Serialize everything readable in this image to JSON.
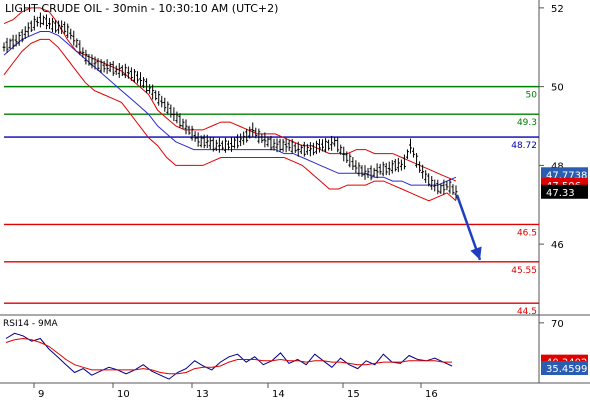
{
  "chart_data": [
    {
      "type": "candlestick",
      "title": "LIGHT CRUDE OIL - 30min - 10:30:10 AM (UTC+2)",
      "x_ticks": [
        "9",
        "10",
        "13",
        "14",
        "15",
        "16"
      ],
      "y_ticks": [
        52,
        50,
        48,
        46
      ],
      "ylim": [
        44.2,
        52.2
      ],
      "grid": false,
      "levels": [
        {
          "value": 50.0,
          "label": "50",
          "color": "#008000"
        },
        {
          "value": 49.3,
          "label": "49.3",
          "color": "#008000"
        },
        {
          "value": 48.72,
          "label": "48.72",
          "color": "#0000b0"
        },
        {
          "value": 46.5,
          "label": "46.5",
          "color": "#e00000"
        },
        {
          "value": 45.55,
          "label": "45.55",
          "color": "#e00000"
        },
        {
          "value": 44.5,
          "label": "44.5",
          "color": "#e00000"
        }
      ],
      "price_tags": [
        {
          "value": 47.7738,
          "label": "47.7738",
          "color": "#2a5db0"
        },
        {
          "value": 47.506,
          "label": "47.506",
          "color": "#e00000"
        },
        {
          "value": 47.33,
          "label": "47.33",
          "color": "#000000"
        }
      ],
      "forecast_arrow": {
        "from": 47.25,
        "to": 45.6,
        "color": "#1f3fbf"
      },
      "price_series": [
        51.0,
        51.1,
        51.2,
        51.4,
        51.6,
        51.7,
        51.6,
        51.5,
        51.5,
        51.3,
        51.0,
        50.7,
        50.6,
        50.5,
        50.5,
        50.4,
        50.4,
        50.3,
        50.2,
        50.0,
        49.8,
        49.6,
        49.4,
        49.2,
        49.0,
        48.8,
        48.6,
        48.6,
        48.5,
        48.5,
        48.5,
        48.6,
        48.7,
        48.9,
        48.7,
        48.6,
        48.5,
        48.5,
        48.5,
        48.4,
        48.4,
        48.4,
        48.5,
        48.5,
        48.6,
        48.3,
        48.1,
        47.9,
        47.8,
        47.8,
        47.9,
        47.9,
        48.0,
        48.0,
        48.5,
        48.0,
        47.7,
        47.5,
        47.4,
        47.5,
        47.3
      ],
      "bollinger_upper": [
        51.6,
        51.7,
        51.9,
        52.0,
        52.0,
        51.9,
        51.6,
        51.2,
        50.9,
        50.8,
        50.7,
        50.6,
        50.5,
        50.4,
        50.2,
        50.0,
        49.8,
        49.4,
        49.2,
        49.0,
        48.9,
        48.9,
        48.9,
        49.0,
        49.1,
        49.1,
        49.0,
        48.9,
        48.8,
        48.8,
        48.8,
        48.7,
        48.6,
        48.5,
        48.5,
        48.4,
        48.3,
        48.3,
        48.3,
        48.4,
        48.4,
        48.3,
        48.3,
        48.3,
        48.2,
        48.1,
        48.0,
        47.9,
        47.8,
        47.7,
        47.6
      ],
      "bollinger_lower": [
        50.3,
        50.6,
        50.9,
        51.1,
        51.2,
        51.2,
        51.0,
        50.7,
        50.4,
        50.1,
        49.9,
        49.8,
        49.7,
        49.6,
        49.3,
        49.0,
        48.7,
        48.5,
        48.2,
        48.0,
        48.0,
        48.0,
        48.0,
        48.1,
        48.2,
        48.2,
        48.2,
        48.2,
        48.2,
        48.2,
        48.2,
        48.2,
        48.1,
        48.0,
        47.8,
        47.6,
        47.4,
        47.4,
        47.5,
        47.5,
        47.5,
        47.6,
        47.6,
        47.5,
        47.4,
        47.3,
        47.2,
        47.1,
        47.2,
        47.3,
        47.1
      ],
      "moving_average": [
        50.8,
        51.0,
        51.2,
        51.3,
        51.4,
        51.4,
        51.3,
        51.1,
        50.9,
        50.7,
        50.5,
        50.3,
        50.1,
        49.9,
        49.7,
        49.5,
        49.3,
        49.0,
        48.8,
        48.6,
        48.5,
        48.4,
        48.4,
        48.4,
        48.4,
        48.4,
        48.4,
        48.4,
        48.4,
        48.4,
        48.4,
        48.3,
        48.3,
        48.2,
        48.1,
        48.0,
        47.9,
        47.8,
        47.8,
        47.8,
        47.8,
        47.7,
        47.7,
        47.6,
        47.6,
        47.5,
        47.5,
        47.5,
        47.5,
        47.6,
        47.7
      ]
    },
    {
      "type": "line",
      "title": "RSI14 - 9MA",
      "y_ticks": [
        70
      ],
      "ylim": [
        24,
        76
      ],
      "series": [
        {
          "values": [
            58,
            62,
            60,
            56,
            58,
            50,
            44,
            38,
            32,
            35,
            30,
            33,
            36,
            34,
            31,
            34,
            38,
            33,
            30,
            27,
            32,
            35,
            41,
            37,
            34,
            40,
            44,
            46,
            40,
            44,
            38,
            41,
            47,
            39,
            42,
            38,
            46,
            41,
            36,
            43,
            38,
            35,
            41,
            38,
            46,
            40,
            39,
            45,
            42,
            41,
            43,
            40,
            37
          ],
          "color": "#00008b"
        },
        {
          "values": [
            55,
            57,
            58,
            57,
            55,
            52,
            47,
            42,
            38,
            36,
            34,
            34,
            34,
            34,
            34,
            34,
            35,
            34,
            32,
            31,
            31,
            32,
            35,
            36,
            36,
            37,
            40,
            42,
            42,
            42,
            41,
            41,
            42,
            41,
            41,
            40,
            41,
            41,
            40,
            40,
            39,
            38,
            38,
            39,
            40,
            40,
            40,
            41,
            41,
            41,
            41,
            40,
            40
          ],
          "color": "#e00000"
        }
      ],
      "price_tags": [
        {
          "value": 40.3402,
          "label": "40.3402",
          "color": "#e00000"
        },
        {
          "value": 35.4599,
          "label": "35.4599",
          "color": "#2a5db0"
        }
      ]
    }
  ]
}
